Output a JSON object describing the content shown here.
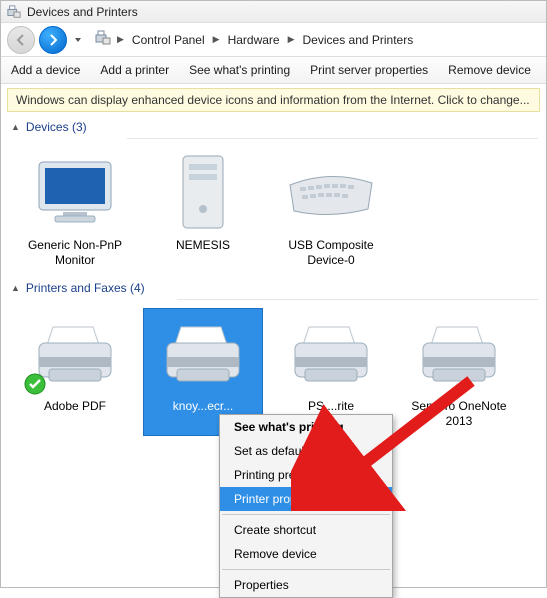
{
  "window": {
    "title": "Devices and Printers"
  },
  "breadcrumbs": {
    "a": "Control Panel",
    "b": "Hardware",
    "c": "Devices and Printers"
  },
  "toolbar": {
    "add_device": "Add a device",
    "add_printer": "Add a printer",
    "see_printing": "See what's printing",
    "server_props": "Print server properties",
    "remove": "Remove device"
  },
  "infobar": "Windows can display enhanced device icons and information from the Internet. Click to change...",
  "groups": {
    "devices": {
      "label": "Devices",
      "count": "(3)"
    },
    "printers": {
      "label": "Printers and Faxes",
      "count": "(4)"
    }
  },
  "devices": [
    {
      "label": "Generic Non-PnP Monitor"
    },
    {
      "label": "NEMESIS"
    },
    {
      "label": "USB Composite Device-0"
    }
  ],
  "printers": [
    {
      "label": "Adobe PDF"
    },
    {
      "label": "knoy...ecr..."
    },
    {
      "label": "PS ...rite"
    },
    {
      "label": "Send To OneNote 2013"
    }
  ],
  "ctx": {
    "see": "See what's printing",
    "set_default": "Set as default printer",
    "prefs": "Printing preferences",
    "props_printer": "Printer properties",
    "shortcut": "Create shortcut",
    "remove": "Remove device",
    "props": "Properties"
  }
}
